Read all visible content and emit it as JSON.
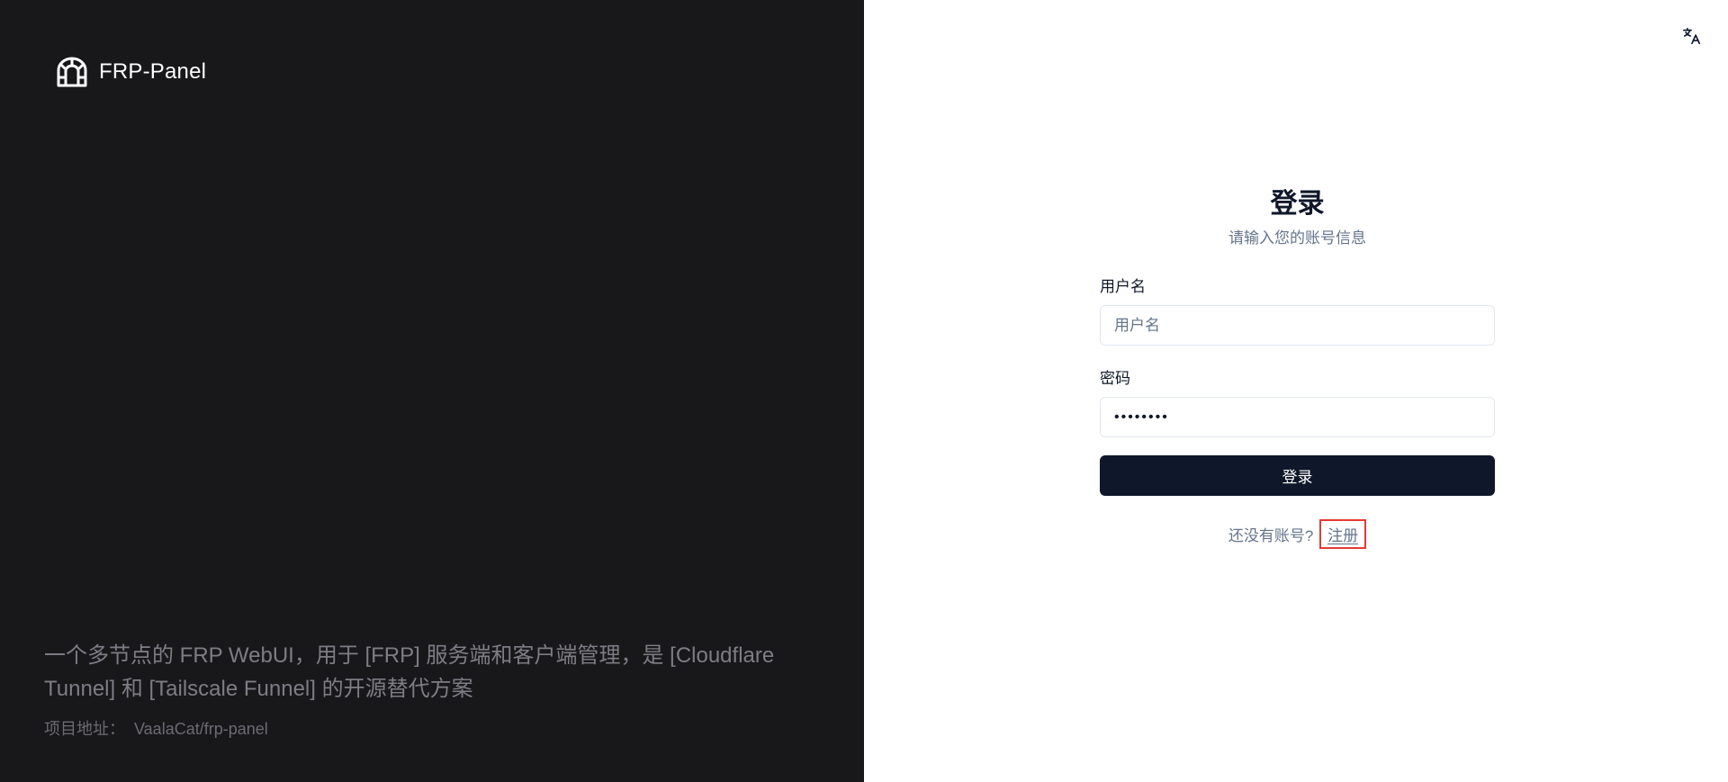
{
  "brand": {
    "name": "FRP-Panel",
    "logo_icon": "tunnel-icon"
  },
  "left_footer": {
    "tagline": "一个多节点的 FRP WebUI，用于 [FRP] 服务端和客户端管理，是 [Cloudflare Tunnel] 和 [Tailscale Funnel] 的开源替代方案",
    "project_label": "项目地址：",
    "project_link": "VaalaCat/frp-panel"
  },
  "header": {
    "language_icon": "translate-icon"
  },
  "login": {
    "title": "登录",
    "subtitle": "请输入您的账号信息",
    "username_label": "用户名",
    "username_placeholder": "用户名",
    "username_value": "",
    "password_label": "密码",
    "password_value": "12345678",
    "submit_label": "登录",
    "no_account_text": "还没有账号?",
    "register_label": "注册"
  },
  "colors": {
    "left_bg": "#18181b",
    "primary_button": "#0f172a",
    "highlight_border": "#e53935"
  }
}
